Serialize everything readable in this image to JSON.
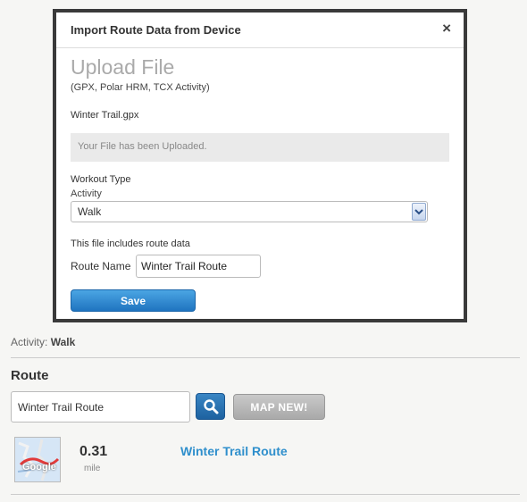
{
  "modal": {
    "title": "Import Route Data from Device",
    "close_label": "×",
    "upload_title": "Upload File",
    "upload_subtitle": "(GPX, Polar HRM, TCX Activity)",
    "filename": "Winter Trail.gpx",
    "upload_status": "Your File has been Uploaded.",
    "workout_type_label": "Workout Type",
    "activity_label": "Activity",
    "activity_value": "Walk",
    "route_data_note": "This file includes route data",
    "route_name_label": "Route Name",
    "route_name_value": "Winter Trail Route",
    "save_label": "Save"
  },
  "page": {
    "activity_prefix": "Activity:",
    "activity_value": "Walk",
    "route_heading": "Route",
    "route_search_value": "Winter Trail Route",
    "map_new_label": "MAP NEW!",
    "route_distance": "0.31",
    "route_unit": "mile",
    "route_link": "Winter Trail Route",
    "map_thumb_label": "Google"
  },
  "colors": {
    "accent_blue": "#2f8fcc",
    "save_button": "#1f74c0",
    "modal_border": "#3a3a3a"
  }
}
